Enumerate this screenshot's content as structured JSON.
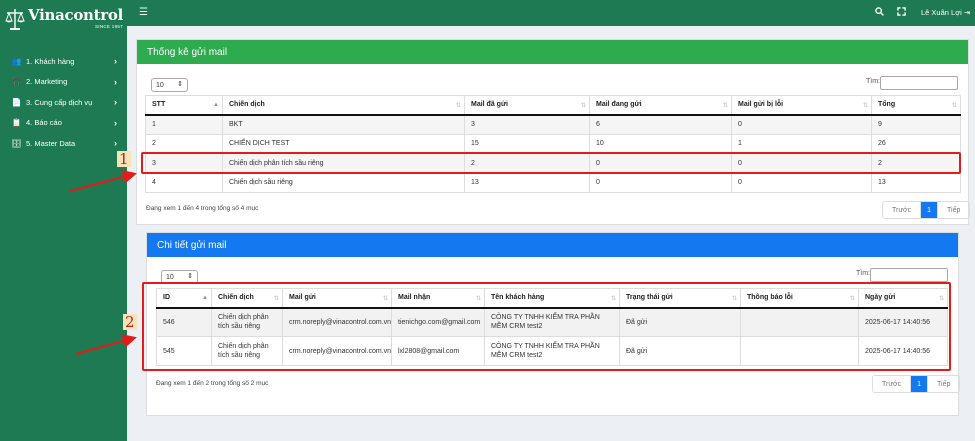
{
  "brand": {
    "name": "Vinacontrol",
    "tagline": "SINCE 1957"
  },
  "sidebar": {
    "items": [
      {
        "label": "1. Khách hàng",
        "icon": "users-icon",
        "glyph": "👥"
      },
      {
        "label": "2. Marketing",
        "icon": "headset-icon",
        "glyph": "🎧"
      },
      {
        "label": "3. Cung cấp dịch vụ",
        "icon": "file-icon",
        "glyph": "📄"
      },
      {
        "label": "4. Báo cáo",
        "icon": "report-icon",
        "glyph": "📋"
      },
      {
        "label": "5. Master Data",
        "icon": "database-icon",
        "glyph": "🗄"
      }
    ]
  },
  "topbar": {
    "user_name": "Lê Xuân Lợi",
    "icons": [
      "menu-icon",
      "search-icon",
      "expand-icon",
      "logout-icon"
    ]
  },
  "stats": {
    "title": "Thống kê gửi mail",
    "page_length": "10",
    "search_label": "Tìm:",
    "search_value": "",
    "columns": [
      "STT",
      "Chiến dịch",
      "Mail đã gửi",
      "Mail đang gửi",
      "Mail gửi bị lỗi",
      "Tổng"
    ],
    "rows": [
      [
        "1",
        "BKT",
        "3",
        "6",
        "0",
        "9"
      ],
      [
        "2",
        "CHIẾN DỊCH TEST",
        "15",
        "10",
        "1",
        "26"
      ],
      [
        "3",
        "Chiến dịch phân tích sầu riêng",
        "2",
        "0",
        "0",
        "2"
      ],
      [
        "4",
        "Chiến dịch sầu riêng",
        "13",
        "0",
        "0",
        "13"
      ]
    ],
    "info": "Đang xem 1 đến 4 trong tổng số 4 mục",
    "pager": {
      "prev": "Trước",
      "current": "1",
      "next": "Tiếp"
    }
  },
  "details": {
    "title": "Chi tiết gửi mail",
    "page_length": "10",
    "search_label": "Tìm:",
    "search_value": "",
    "columns": [
      "ID",
      "Chiến dịch",
      "Mail gửi",
      "Mail nhận",
      "Tên khách hàng",
      "Trạng thái gửi",
      "Thông báo lỗi",
      "Ngày gửi"
    ],
    "rows": [
      [
        "546",
        "Chiến dịch phân tích sầu riêng",
        "crm.noreply@vinacontrol.com.vn",
        "tienichgo.com@gmail.com",
        "CÔNG TY TNHH KIỂM TRA PHẦN MỀM CRM test2",
        "Đã gửi",
        "",
        "2025-06-17 14:40:56"
      ],
      [
        "545",
        "Chiến dịch phân tích sầu riêng",
        "crm.noreply@vinacontrol.com.vn",
        "lxl2808@gmail.com",
        "CÔNG TY TNHH KIỂM TRA PHẦN MỀM CRM test2",
        "Đã gửi",
        "",
        "2025-06-17 14:40:56"
      ]
    ],
    "info": "Đang xem 1 đến 2 trong tổng số 2 mục",
    "pager": {
      "prev": "Trước",
      "current": "1",
      "next": "Tiếp"
    }
  },
  "annotations": {
    "one": "1",
    "two": "2",
    "color": "#e31b1b"
  },
  "colors": {
    "sidebar": "#1e7a52",
    "stats_header": "#2eaa4f",
    "details_header": "#1479f0"
  }
}
